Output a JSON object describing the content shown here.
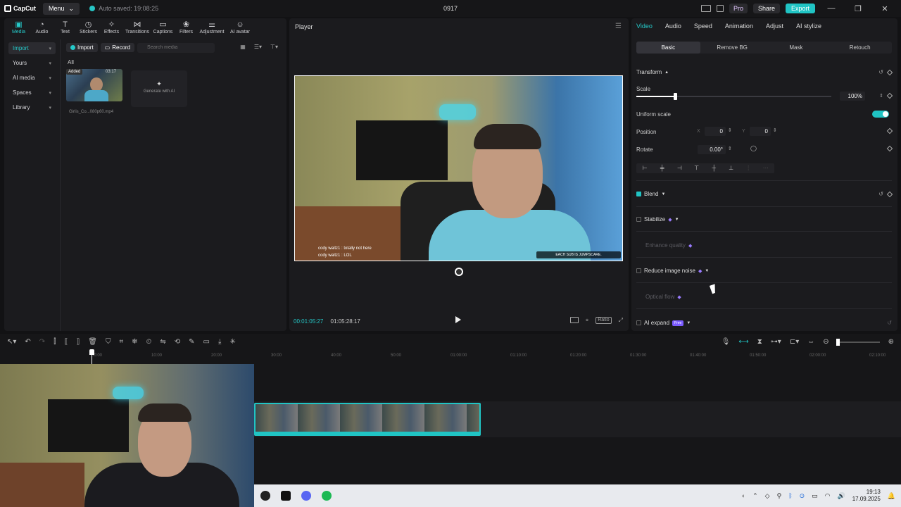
{
  "titlebar": {
    "app_name": "CapCut",
    "menu_label": "Menu",
    "autosave": "Auto saved: 19:08:25",
    "project_title": "0917",
    "pro_label": "Pro",
    "share_label": "Share",
    "export_label": "Export"
  },
  "toolbar": {
    "tabs": [
      {
        "label": "Media",
        "icon": "media-icon"
      },
      {
        "label": "Audio",
        "icon": "audio-icon"
      },
      {
        "label": "Text",
        "icon": "text-icon"
      },
      {
        "label": "Stickers",
        "icon": "stickers-icon"
      },
      {
        "label": "Effects",
        "icon": "effects-icon"
      },
      {
        "label": "Transitions",
        "icon": "transitions-icon"
      },
      {
        "label": "Captions",
        "icon": "captions-icon"
      },
      {
        "label": "Filters",
        "icon": "filters-icon"
      },
      {
        "label": "Adjustment",
        "icon": "adjustment-icon"
      },
      {
        "label": "AI avatar",
        "icon": "ai-avatar-icon"
      }
    ]
  },
  "sidebar": {
    "items": [
      "Import",
      "Yours",
      "AI media",
      "Spaces",
      "Library"
    ]
  },
  "media": {
    "import_label": "Import",
    "record_label": "Record",
    "search_placeholder": "Search media",
    "filter_label": "All",
    "clip": {
      "badge": "Added",
      "date": "03:17",
      "name": "Girlis_Co...080p60.mp4"
    },
    "generate_label": "Generate with AI"
  },
  "player": {
    "title": "Player",
    "chat_line1": "cody waltz1 : totally not here",
    "chat_line2": "cody waltz1 : LOL",
    "sub_banner": "EACH SUB IS JUMPSCARE.",
    "current_time": "00:01:05:27",
    "duration": "01:05:28:17",
    "ratio_label": "Ratio"
  },
  "inspector": {
    "tabs": [
      "Video",
      "Audio",
      "Speed",
      "Animation",
      "Adjust",
      "AI stylize"
    ],
    "sub_tabs": [
      "Basic",
      "Remove BG",
      "Mask",
      "Retouch"
    ],
    "transform_label": "Transform",
    "scale_label": "Scale",
    "scale_value": "100%",
    "scale_fraction": 0.2,
    "uniform_scale_label": "Uniform scale",
    "position_label": "Position",
    "pos_x_label": "X",
    "pos_x": "0",
    "pos_y_label": "Y",
    "pos_y": "0",
    "rotate_label": "Rotate",
    "rotate_value": "0.00°",
    "blend_label": "Blend",
    "stabilize_label": "Stabilize",
    "enhance_label": "Enhance quality",
    "noise_label": "Reduce image noise",
    "optical_label": "Optical flow",
    "ai_expand_label": "AI expand",
    "free_badge": "Free"
  },
  "timeline": {
    "ticks": [
      "00:00",
      "10:00",
      "20:00",
      "30:00",
      "40:00",
      "50:00",
      "01:00:00",
      "01:10:00",
      "01:20:00",
      "01:30:00",
      "01:40:00",
      "01:50:00",
      "02:00:00",
      "02:10:00"
    ]
  },
  "taskbar": {
    "time": "19:13",
    "date": "17.09.2025"
  },
  "colors": {
    "accent": "#20c4c4",
    "pro": "#7b5cff"
  }
}
